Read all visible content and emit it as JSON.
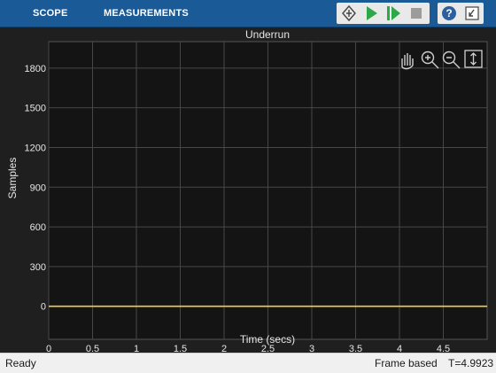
{
  "toolstrip": {
    "tabs": [
      {
        "label": "SCOPE"
      },
      {
        "label": "MEASUREMENTS"
      }
    ],
    "icons": [
      "step-back-icon",
      "run-icon",
      "step-forward-icon",
      "stop-icon",
      "help-icon",
      "dock-icon"
    ]
  },
  "axes_toolbar": {
    "icons": [
      "pan-icon",
      "zoom-in-icon",
      "zoom-out-icon",
      "autoscale-icon"
    ]
  },
  "colors": {
    "toolstrip": "#1a5a96",
    "figure_background": "#1f1f1f",
    "axes_background": "#141414",
    "grid": "#474747",
    "text": "#e6e6e6",
    "trace": "#f0d23c"
  },
  "status": {
    "left": "Ready",
    "mode": "Frame based",
    "time": "T=4.9923"
  },
  "chart_data": {
    "type": "line",
    "title": "Underrun",
    "xlabel": "Time (secs)",
    "ylabel": "Samples",
    "xlim": [
      0,
      5
    ],
    "ylim": [
      -250,
      2000
    ],
    "xticks": [
      0,
      0.5,
      1,
      1.5,
      2,
      2.5,
      3,
      3.5,
      4,
      4.5
    ],
    "xtick_labels": [
      "0",
      "0.5",
      "1",
      "1.5",
      "2",
      "2.5",
      "3",
      "3.5",
      "4",
      "4.5"
    ],
    "yticks": [
      0,
      300,
      600,
      900,
      1200,
      1500,
      1800
    ],
    "ytick_labels": [
      "0",
      "300",
      "600",
      "900",
      "1200",
      "1500",
      "1800"
    ],
    "grid": true,
    "series": [
      {
        "x": [
          0,
          5
        ],
        "y": [
          0,
          0
        ],
        "color": "#f0d23c"
      }
    ]
  }
}
